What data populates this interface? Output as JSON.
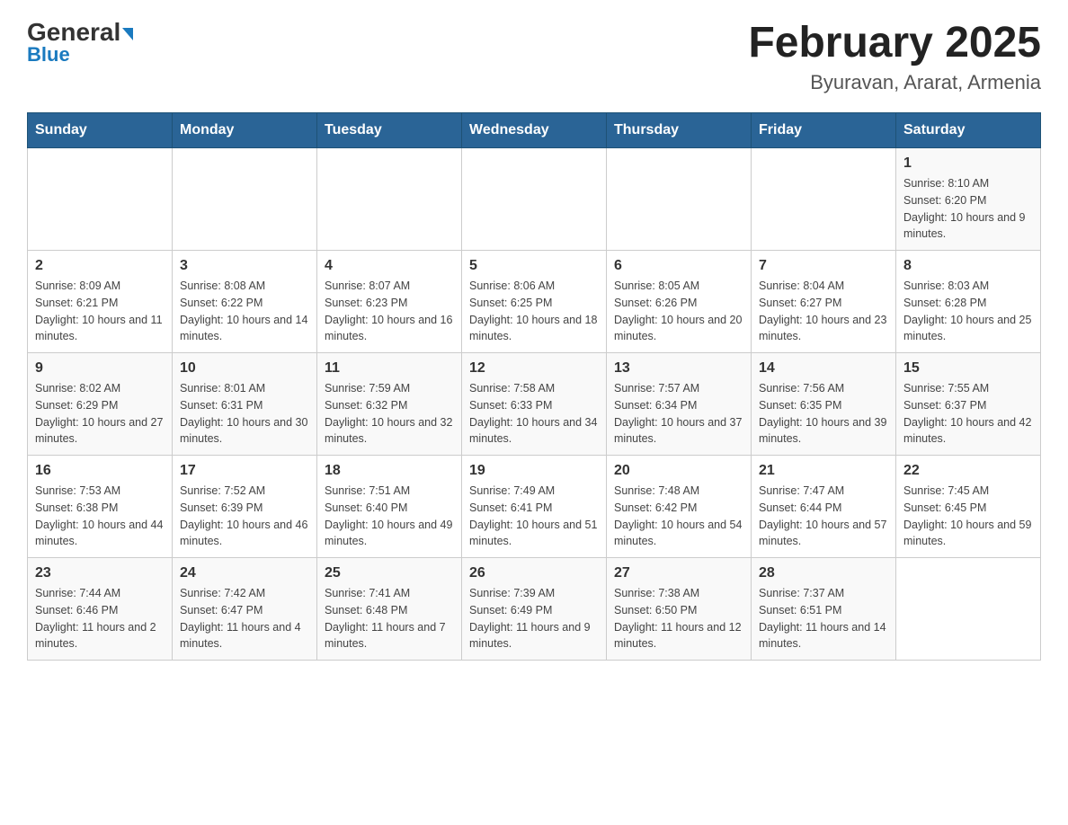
{
  "header": {
    "logo_general": "General",
    "logo_blue": "Blue",
    "title": "February 2025",
    "subtitle": "Byuravan, Ararat, Armenia"
  },
  "calendar": {
    "days_of_week": [
      "Sunday",
      "Monday",
      "Tuesday",
      "Wednesday",
      "Thursday",
      "Friday",
      "Saturday"
    ],
    "weeks": [
      [
        {
          "day": "",
          "info": ""
        },
        {
          "day": "",
          "info": ""
        },
        {
          "day": "",
          "info": ""
        },
        {
          "day": "",
          "info": ""
        },
        {
          "day": "",
          "info": ""
        },
        {
          "day": "",
          "info": ""
        },
        {
          "day": "1",
          "info": "Sunrise: 8:10 AM\nSunset: 6:20 PM\nDaylight: 10 hours and 9 minutes."
        }
      ],
      [
        {
          "day": "2",
          "info": "Sunrise: 8:09 AM\nSunset: 6:21 PM\nDaylight: 10 hours and 11 minutes."
        },
        {
          "day": "3",
          "info": "Sunrise: 8:08 AM\nSunset: 6:22 PM\nDaylight: 10 hours and 14 minutes."
        },
        {
          "day": "4",
          "info": "Sunrise: 8:07 AM\nSunset: 6:23 PM\nDaylight: 10 hours and 16 minutes."
        },
        {
          "day": "5",
          "info": "Sunrise: 8:06 AM\nSunset: 6:25 PM\nDaylight: 10 hours and 18 minutes."
        },
        {
          "day": "6",
          "info": "Sunrise: 8:05 AM\nSunset: 6:26 PM\nDaylight: 10 hours and 20 minutes."
        },
        {
          "day": "7",
          "info": "Sunrise: 8:04 AM\nSunset: 6:27 PM\nDaylight: 10 hours and 23 minutes."
        },
        {
          "day": "8",
          "info": "Sunrise: 8:03 AM\nSunset: 6:28 PM\nDaylight: 10 hours and 25 minutes."
        }
      ],
      [
        {
          "day": "9",
          "info": "Sunrise: 8:02 AM\nSunset: 6:29 PM\nDaylight: 10 hours and 27 minutes."
        },
        {
          "day": "10",
          "info": "Sunrise: 8:01 AM\nSunset: 6:31 PM\nDaylight: 10 hours and 30 minutes."
        },
        {
          "day": "11",
          "info": "Sunrise: 7:59 AM\nSunset: 6:32 PM\nDaylight: 10 hours and 32 minutes."
        },
        {
          "day": "12",
          "info": "Sunrise: 7:58 AM\nSunset: 6:33 PM\nDaylight: 10 hours and 34 minutes."
        },
        {
          "day": "13",
          "info": "Sunrise: 7:57 AM\nSunset: 6:34 PM\nDaylight: 10 hours and 37 minutes."
        },
        {
          "day": "14",
          "info": "Sunrise: 7:56 AM\nSunset: 6:35 PM\nDaylight: 10 hours and 39 minutes."
        },
        {
          "day": "15",
          "info": "Sunrise: 7:55 AM\nSunset: 6:37 PM\nDaylight: 10 hours and 42 minutes."
        }
      ],
      [
        {
          "day": "16",
          "info": "Sunrise: 7:53 AM\nSunset: 6:38 PM\nDaylight: 10 hours and 44 minutes."
        },
        {
          "day": "17",
          "info": "Sunrise: 7:52 AM\nSunset: 6:39 PM\nDaylight: 10 hours and 46 minutes."
        },
        {
          "day": "18",
          "info": "Sunrise: 7:51 AM\nSunset: 6:40 PM\nDaylight: 10 hours and 49 minutes."
        },
        {
          "day": "19",
          "info": "Sunrise: 7:49 AM\nSunset: 6:41 PM\nDaylight: 10 hours and 51 minutes."
        },
        {
          "day": "20",
          "info": "Sunrise: 7:48 AM\nSunset: 6:42 PM\nDaylight: 10 hours and 54 minutes."
        },
        {
          "day": "21",
          "info": "Sunrise: 7:47 AM\nSunset: 6:44 PM\nDaylight: 10 hours and 57 minutes."
        },
        {
          "day": "22",
          "info": "Sunrise: 7:45 AM\nSunset: 6:45 PM\nDaylight: 10 hours and 59 minutes."
        }
      ],
      [
        {
          "day": "23",
          "info": "Sunrise: 7:44 AM\nSunset: 6:46 PM\nDaylight: 11 hours and 2 minutes."
        },
        {
          "day": "24",
          "info": "Sunrise: 7:42 AM\nSunset: 6:47 PM\nDaylight: 11 hours and 4 minutes."
        },
        {
          "day": "25",
          "info": "Sunrise: 7:41 AM\nSunset: 6:48 PM\nDaylight: 11 hours and 7 minutes."
        },
        {
          "day": "26",
          "info": "Sunrise: 7:39 AM\nSunset: 6:49 PM\nDaylight: 11 hours and 9 minutes."
        },
        {
          "day": "27",
          "info": "Sunrise: 7:38 AM\nSunset: 6:50 PM\nDaylight: 11 hours and 12 minutes."
        },
        {
          "day": "28",
          "info": "Sunrise: 7:37 AM\nSunset: 6:51 PM\nDaylight: 11 hours and 14 minutes."
        },
        {
          "day": "",
          "info": ""
        }
      ]
    ]
  }
}
